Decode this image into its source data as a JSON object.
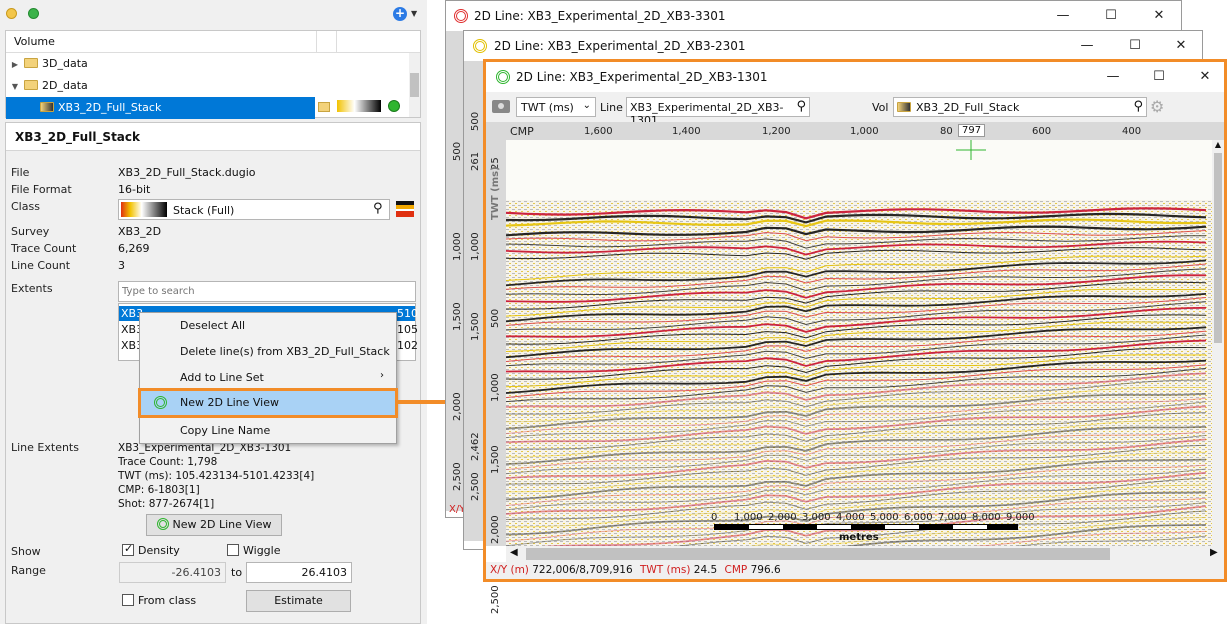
{
  "left": {
    "tree_header": "Volume",
    "tree_items": [
      "3D_data",
      "2D_data",
      "XB3_2D_Full_Stack"
    ],
    "title": "XB3_2D_Full_Stack",
    "props": {
      "file_label": "File",
      "file": "XB3_2D_Full_Stack.dugio",
      "format_label": "File Format",
      "format": "16-bit",
      "class_label": "Class",
      "class": "Stack (Full)",
      "survey_label": "Survey",
      "survey": "XB3_2D",
      "trace_count_label": "Trace Count",
      "trace_count": "6,269",
      "line_count_label": "Line Count",
      "line_count": "3",
      "extents_label": "Extents",
      "search_placeholder": "Type to search",
      "list_rows": [
        "XB3_",
        "XB3_",
        "XB3_"
      ],
      "list_suffix": [
        "510",
        "105",
        "102"
      ],
      "line_extents_label": "Line Extents",
      "line_extents": [
        "XB3_Experimental_2D_XB3-1301",
        "Trace Count: 1,798",
        "TWT (ms): 105.423134-5101.4233[4]",
        "CMP: 6-1803[1]",
        "Shot: 877-2674[1]"
      ],
      "new_view_btn": "New 2D Line View",
      "show_label": "Show",
      "density": "Density",
      "wiggle": "Wiggle",
      "range_label": "Range",
      "range_min": "-26.4103",
      "range_to": "to",
      "range_max": "26.4103",
      "from_class": "From class",
      "estimate": "Estimate"
    },
    "context_menu": [
      "Deselect All",
      "Delete line(s) from XB3_2D_Full_Stack",
      "Add to Line Set",
      "New 2D Line View",
      "Copy Line Name"
    ]
  },
  "windows": {
    "w1_title": "2D Line: XB3_Experimental_2D_XB3-3301",
    "w2_title": "2D Line: XB3_Experimental_2D_XB3-2301",
    "w3_title": "2D Line: XB3_Experimental_2D_XB3-1301",
    "twt_select": "TWT (ms)",
    "line_label": "Line",
    "line_value": "XB3_Experimental_2D_XB3-1301",
    "vol_label": "Vol",
    "vol_value": "XB3_2D_Full_Stack",
    "cmp_label": "CMP",
    "cmp_ticks": [
      "1,600",
      "1,400",
      "1,200",
      "1,000",
      "80",
      "797",
      "600",
      "400"
    ],
    "twt_ticks": [
      "25",
      "500",
      "1,000",
      "1,500",
      "2,000",
      "2,500"
    ],
    "twt_axis_label": "TWT (ms)",
    "scale_ticks": [
      "0",
      "1,000",
      "2,000",
      "3,000",
      "4,000",
      "5,000",
      "6,000",
      "7,000",
      "8,000",
      "9,000"
    ],
    "scale_unit": "metres",
    "status": {
      "xy_label": "X/Y (m)",
      "xy": "722,006/8,709,916",
      "twt_label": "TWT (ms)",
      "twt": "24.5",
      "cmp_label": "CMP",
      "cmp": "796.6"
    },
    "bg_ticks": [
      "500",
      "1,000",
      "1,500",
      "2,000",
      "2,500"
    ],
    "bg_ticks2": [
      "261",
      "500",
      "1,000",
      "1,500",
      "2,462",
      "2,500"
    ],
    "bg_status": "X/Y"
  },
  "colors": {
    "accent": "#f28c28",
    "selection": "#0078d7",
    "green": "#2fb52f"
  }
}
